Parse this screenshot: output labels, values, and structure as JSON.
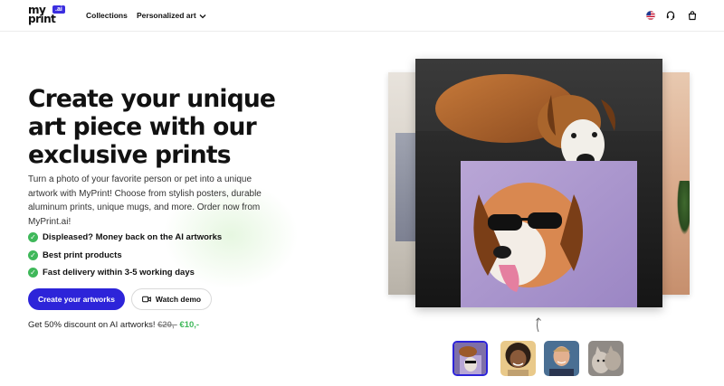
{
  "header": {
    "logo_line1": "my",
    "logo_line2": "print",
    "logo_badge": ".ai",
    "nav": {
      "collections": "Collections",
      "personalized_art": "Personalized art"
    },
    "icons": [
      "us-flag-icon",
      "headset-support-icon",
      "shopping-bag-icon"
    ]
  },
  "hero": {
    "title": "Create your unique art piece with our exclusive prints",
    "description": "Turn a photo of your favorite person or pet into a unique artwork with MyPrint! Choose from stylish posters, durable aluminum prints, unique mugs, and more. Order now from MyPrint.ai!",
    "features": [
      "Displeased? Money back on the AI artworks",
      "Best print products",
      "Fast delivery within 3-5 working days"
    ],
    "primary_button": "Create your artworks",
    "secondary_button": "Watch demo",
    "discount": {
      "text": "Get 50% discount on AI artworks!",
      "old_price": "€20,-",
      "new_price": "€10,-"
    }
  },
  "gallery": {
    "thumbnails": [
      "dog-thumbnail",
      "girl-thumbnail",
      "man-thumbnail",
      "cat-thumbnail"
    ],
    "active_index": 0
  },
  "colors": {
    "primary": "#2d24d9",
    "check_green": "#3fb85a",
    "text": "#111111"
  }
}
